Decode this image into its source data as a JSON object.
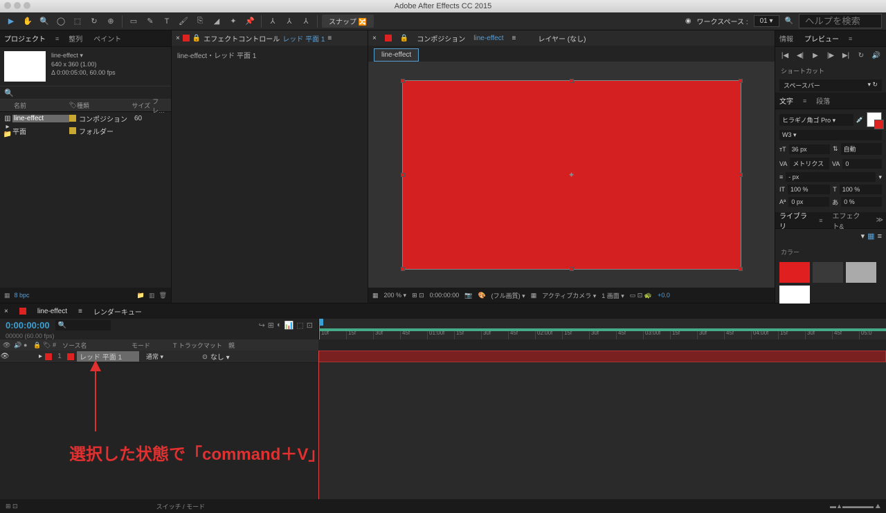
{
  "app": {
    "title": "Adobe After Effects CC 2015"
  },
  "toolbar": {
    "snap_label": "スナップ",
    "workspace_label": "ワークスペース :",
    "workspace_value": "01",
    "help_placeholder": "ヘルプを検索"
  },
  "project": {
    "tab_project": "プロジェクト",
    "tab_align": "整列",
    "tab_paint": "ペイント",
    "comp_name": "line-effect ▾",
    "dimensions": "640 x 360 (1.00)",
    "duration": "Δ 0:00:05:00, 60.00 fps",
    "col_name": "名前",
    "col_type": "種類",
    "col_size": "サイズ",
    "col_fr": "フレ…",
    "items": [
      {
        "name": "line-effect",
        "type": "コンポジション",
        "size": "60"
      },
      {
        "name": "平面",
        "type": "フォルダー",
        "size": ""
      }
    ],
    "bpc": "8 bpc"
  },
  "effect": {
    "tab_label": "エフェクトコントロール",
    "layer_name": "レッド 平面 1",
    "breadcrumb": "line-effect・レッド 平面 1"
  },
  "composition": {
    "tab_comp": "コンポジション",
    "comp_name": "line-effect",
    "tab_layer": "レイヤー (なし)",
    "active_tab": "line-effect",
    "footer": {
      "zoom": "200 %",
      "time": "0:00:00:00",
      "quality": "(フル画質)",
      "camera": "アクティブカメラ",
      "view": "1 画面",
      "exposure": "+0.0"
    }
  },
  "rightPanels": {
    "tab_info": "情報",
    "tab_preview": "プレビュー",
    "shortcut_label": "ショートカット",
    "shortcut_value": "スペースバー",
    "tab_char": "文字",
    "tab_para": "段落",
    "font_family": "ヒラギノ角ゴ Pro",
    "font_weight": "W3",
    "font_size": "36 px",
    "leading": "自動",
    "kerning": "メトリクス",
    "tracking": "0",
    "baseline": "- px",
    "scale_v": "100 %",
    "scale_h": "100 %",
    "baseline_shift": "0 px",
    "tsume": "0 %",
    "tab_library": "ライブラリ",
    "tab_effects": "エフェクト&",
    "color_label": "カラー",
    "swatches": [
      "#e02020",
      "#3a3a3a",
      "#aaaaaa",
      "#ffffff"
    ]
  },
  "timeline": {
    "tab_comp": "line-effect",
    "tab_render": "レンダーキュー",
    "timecode": "0:00:00:00",
    "frames": "00000 (60.00 fps)",
    "col_source": "ソース名",
    "col_mode": "モード",
    "col_trkmat": "T トラックマット",
    "col_parent": "親",
    "ruler_marks": [
      "10f",
      "15f",
      "30f",
      "45f",
      "01:00f",
      "15f",
      "30f",
      "45f",
      "02:00f",
      "15f",
      "30f",
      "45f",
      "03:00f",
      "15f",
      "30f",
      "45f",
      "04:00f",
      "15f",
      "30f",
      "45f",
      "05:0"
    ],
    "layers": [
      {
        "num": "1",
        "name": "レッド 平面 1",
        "mode": "通常",
        "trkmat": "なし"
      }
    ],
    "switch_label": "スイッチ / モード"
  },
  "annotation": {
    "text": "選択した状態で「command＋V」"
  }
}
